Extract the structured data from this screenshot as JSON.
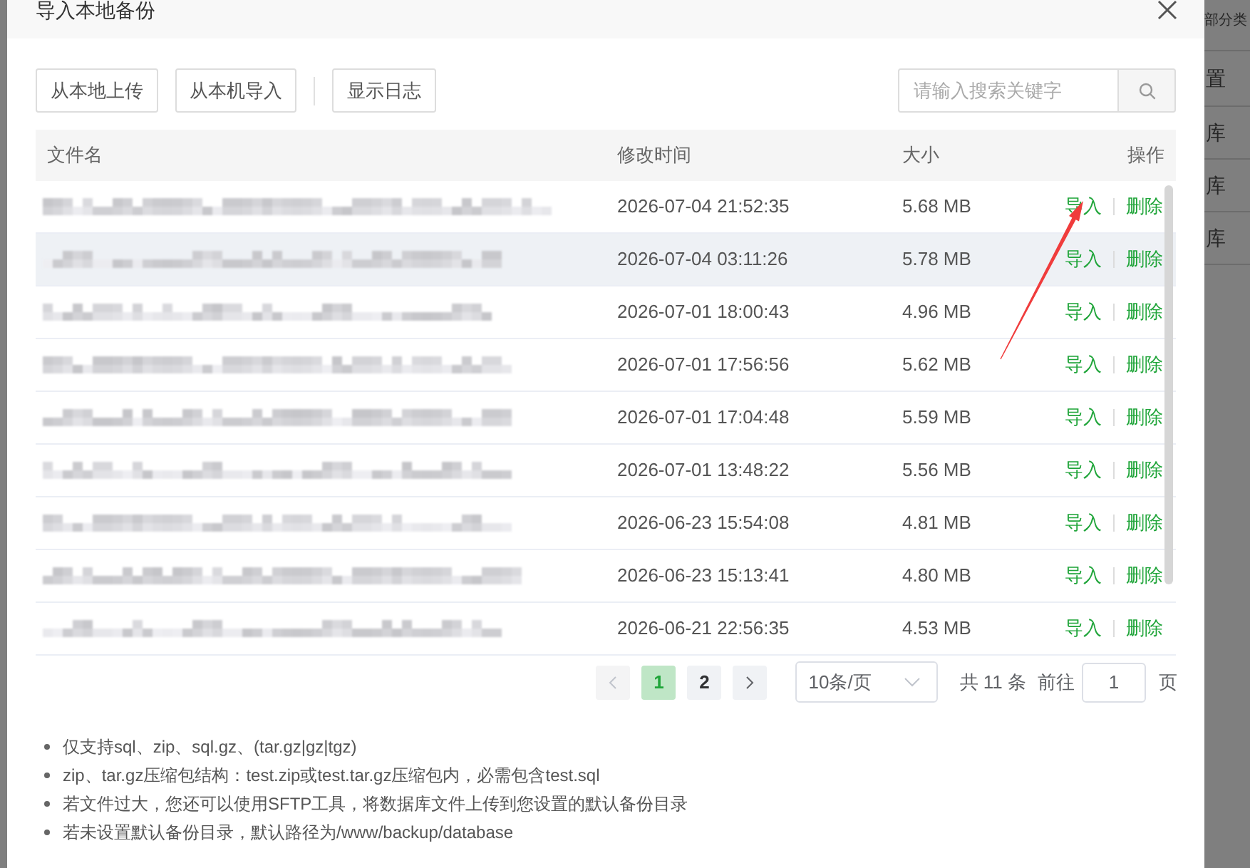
{
  "window": {
    "title": "导入本地备份"
  },
  "background_page": {
    "header": "部分类",
    "cells": [
      "置",
      "库",
      "库",
      "库"
    ]
  },
  "toolbar": {
    "groups": [
      [
        {
          "label": "从本地上传"
        },
        {
          "label": "从本机导入"
        }
      ],
      [
        {
          "label": "显示日志"
        }
      ]
    ],
    "search": {
      "placeholder": "请输入搜索关键字"
    }
  },
  "table": {
    "columns": [
      "文件名",
      "修改时间",
      "大小",
      "操作"
    ],
    "rows": [
      {
        "modified": "2026-07-04 21:52:35",
        "size": "5.68 MB",
        "actions": [
          "导入",
          "删除"
        ],
        "highlighted": false
      },
      {
        "modified": "2026-07-04 03:11:26",
        "size": "5.78 MB",
        "actions": [
          "导入",
          "删除"
        ],
        "highlighted": true
      },
      {
        "modified": "2026-07-01 18:00:43",
        "size": "4.96 MB",
        "actions": [
          "导入",
          "删除"
        ],
        "highlighted": false
      },
      {
        "modified": "2026-07-01 17:56:56",
        "size": "5.62 MB",
        "actions": [
          "导入",
          "删除"
        ],
        "highlighted": false
      },
      {
        "modified": "2026-07-01 17:04:48",
        "size": "5.59 MB",
        "actions": [
          "导入",
          "删除"
        ],
        "highlighted": false
      },
      {
        "modified": "2026-07-01 13:48:22",
        "size": "5.56 MB",
        "actions": [
          "导入",
          "删除"
        ],
        "highlighted": false
      },
      {
        "modified": "2026-06-23 15:54:08",
        "size": "4.81 MB",
        "actions": [
          "导入",
          "删除"
        ],
        "highlighted": false
      },
      {
        "modified": "2026-06-23 15:13:41",
        "size": "4.80 MB",
        "actions": [
          "导入",
          "删除"
        ],
        "highlighted": false
      },
      {
        "modified": "2026-06-21 22:56:35",
        "size": "4.53 MB",
        "actions": [
          "导入",
          "删除"
        ],
        "highlighted": false
      }
    ]
  },
  "pagination": {
    "prev": {
      "disabled": true
    },
    "pages": [
      {
        "label": "1",
        "selected": true
      },
      {
        "label": "2",
        "selected": false
      }
    ],
    "next": {
      "disabled": false
    },
    "page_size": "10条/页",
    "total": "共 11 条",
    "goto_label": "前往",
    "goto_value": "1",
    "page_suffix": "页"
  },
  "notes": [
    "仅支持sql、zip、sql.gz、(tar.gz|gz|tgz)",
    "zip、tar.gz压缩包结构：test.zip或test.tar.gz压缩包内，必需包含test.sql",
    "若文件过大，您还可以使用SFTP工具，将数据库文件上传到您设置的默认备份目录",
    "若未设置默认备份目录，默认路径为/www/backup/database"
  ]
}
